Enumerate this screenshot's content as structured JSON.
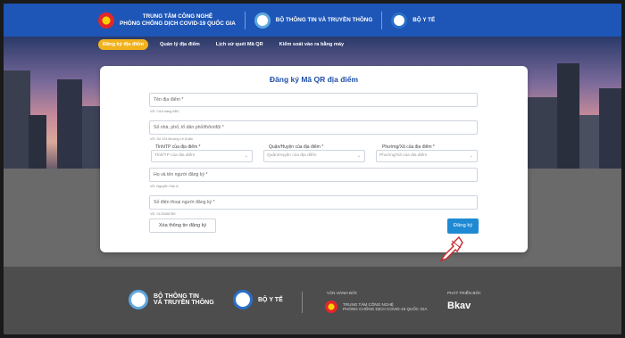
{
  "header": {
    "brand1_line1": "TRUNG TÂM CÔNG NGHỆ",
    "brand1_line2": "PHÒNG CHỐNG DỊCH COVID-19 QUỐC GIA",
    "brand2": "BỘ THÔNG TIN VÀ TRUYỀN THÔNG",
    "brand3": "BỘ Y TẾ"
  },
  "nav": {
    "items": [
      {
        "label": "Đăng ký địa điểm"
      },
      {
        "label": "Quản lý địa điểm"
      },
      {
        "label": "Lịch sử quét Mã QR"
      },
      {
        "label": "Kiểm soát vào ra bằng máy"
      }
    ]
  },
  "form": {
    "title": "Đăng ký Mã QR địa điểm",
    "name_placeholder": "Tên địa điểm *",
    "name_hint": "VD: Cửa hàng ABC",
    "address_placeholder": "Số nhà, phố, tổ dân phố/thôn/đội *",
    "address_hint": "VD: Số 123 Đường Lê Duẩn",
    "province_label": "Tỉnh/TP của địa điểm *",
    "province_value": "Tỉnh/TP của địa điểm",
    "district_label": "Quận/Huyện của địa điểm *",
    "district_value": "Quận/Huyện của địa điểm",
    "ward_label": "Phường/Xã của địa điểm *",
    "ward_value": "Phường/Xã của địa điểm",
    "person_placeholder": "Họ và tên người đăng ký *",
    "person_hint": "VD: Nguyễn Văn A",
    "phone_placeholder": "Số điện thoại người đăng ký *",
    "phone_hint": "VD: 0123456789",
    "clear_label": "Xóa thông tin đăng ký",
    "submit_label": "Đăng ký"
  },
  "footer": {
    "mic_line1": "BỘ THÔNG TIN",
    "mic_line2": "VÀ TRUYỀN THÔNG",
    "moh": "BỘ Y TẾ",
    "operated_label": "VẬN HÀNH BỞI:",
    "op_line1": "TRUNG TÂM CÔNG NGHỆ",
    "op_line2": "PHÒNG CHỐNG DỊCH COVID-19 QUỐC GIA",
    "developed_label": "PHÁT TRIỂN BỞI:",
    "developer": "Bkav"
  },
  "colors": {
    "topbar": "#1e56b8",
    "accent": "#f2b21d",
    "submit": "#1f8ad4",
    "footer": "#4d4d4d"
  }
}
